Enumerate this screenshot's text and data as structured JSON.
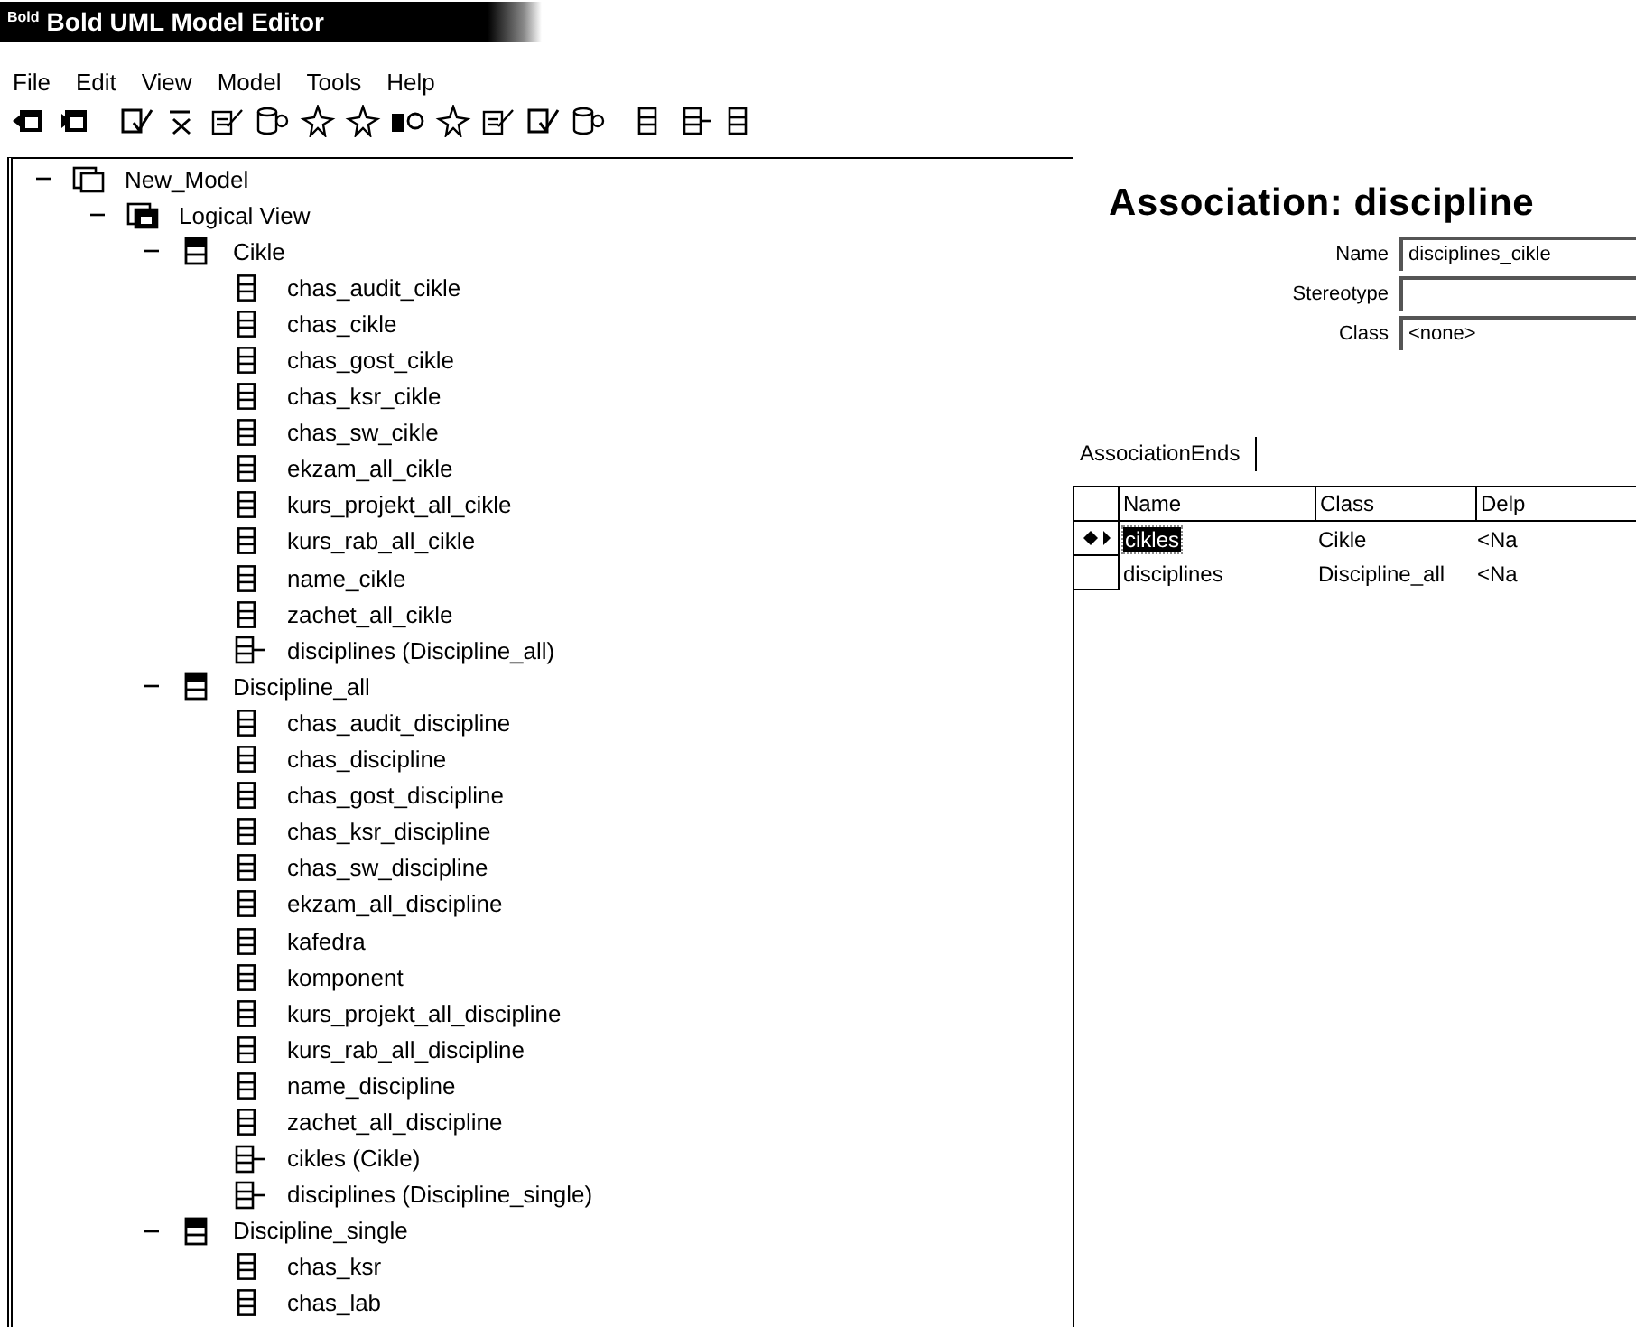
{
  "window": {
    "logo": "Bold",
    "title": "Bold UML Model Editor"
  },
  "menu": [
    "File",
    "Edit",
    "View",
    "Model",
    "Tools",
    "Help"
  ],
  "toolbar": [
    {
      "kind": "import"
    },
    {
      "kind": "export"
    },
    {
      "kind": "ocl"
    },
    {
      "kind": "name-check"
    },
    {
      "kind": "edit"
    },
    {
      "kind": "database"
    },
    {
      "kind": "link"
    },
    {
      "kind": "connect"
    },
    {
      "kind": "generate"
    },
    {
      "kind": "class-new"
    },
    {
      "kind": "doc"
    },
    {
      "kind": "doc-check"
    },
    {
      "kind": "stack"
    },
    {
      "kind": "attribute"
    },
    {
      "kind": "role"
    },
    {
      "kind": "attribute"
    }
  ],
  "tree": [
    {
      "label": "New_Model",
      "kind": "model",
      "expanded": true,
      "children": [
        {
          "label": "Logical View",
          "kind": "package",
          "expanded": true,
          "children": [
            {
              "label": "Cikle",
              "kind": "class",
              "expanded": true,
              "children": [
                {
                  "label": "chas_audit_cikle",
                  "kind": "attribute"
                },
                {
                  "label": "chas_cikle",
                  "kind": "attribute"
                },
                {
                  "label": "chas_gost_cikle",
                  "kind": "attribute"
                },
                {
                  "label": "chas_ksr_cikle",
                  "kind": "attribute"
                },
                {
                  "label": "chas_sw_cikle",
                  "kind": "attribute"
                },
                {
                  "label": "ekzam_all_cikle",
                  "kind": "attribute"
                },
                {
                  "label": "kurs_projekt_all_cikle",
                  "kind": "attribute"
                },
                {
                  "label": "kurs_rab_all_cikle",
                  "kind": "attribute"
                },
                {
                  "label": "name_cikle",
                  "kind": "attribute"
                },
                {
                  "label": "zachet_all_cikle",
                  "kind": "attribute"
                },
                {
                  "label": "disciplines (Discipline_all)",
                  "kind": "role"
                }
              ]
            },
            {
              "label": "Discipline_all",
              "kind": "class",
              "expanded": true,
              "children": [
                {
                  "label": "chas_audit_discipline",
                  "kind": "attribute"
                },
                {
                  "label": "chas_discipline",
                  "kind": "attribute"
                },
                {
                  "label": "chas_gost_discipline",
                  "kind": "attribute"
                },
                {
                  "label": "chas_ksr_discipline",
                  "kind": "attribute"
                },
                {
                  "label": "chas_sw_discipline",
                  "kind": "attribute"
                },
                {
                  "label": "ekzam_all_discipline",
                  "kind": "attribute"
                },
                {
                  "label": "kafedra",
                  "kind": "attribute"
                },
                {
                  "label": "komponent",
                  "kind": "attribute"
                },
                {
                  "label": "kurs_projekt_all_discipline",
                  "kind": "attribute"
                },
                {
                  "label": "kurs_rab_all_discipline",
                  "kind": "attribute"
                },
                {
                  "label": "name_discipline",
                  "kind": "attribute"
                },
                {
                  "label": "zachet_all_discipline",
                  "kind": "attribute"
                },
                {
                  "label": "cikles (Cikle)",
                  "kind": "role"
                },
                {
                  "label": "disciplines (Discipline_single)",
                  "kind": "role"
                }
              ]
            },
            {
              "label": "Discipline_single",
              "kind": "class",
              "expanded": true,
              "children": [
                {
                  "label": "chas_ksr",
                  "kind": "attribute"
                },
                {
                  "label": "chas_lab",
                  "kind": "attribute"
                }
              ]
            }
          ]
        }
      ]
    }
  ],
  "detail": {
    "heading": "Association: discipline",
    "fields": [
      {
        "label": "Name",
        "value": "disciplines_cikle"
      },
      {
        "label": "Stereotype"
      },
      {
        "label": "Class",
        "value": "<none>"
      }
    ],
    "tab": "AssociationEnds",
    "grid": {
      "columns": [
        "Name",
        "Class",
        "Delp"
      ],
      "rows": [
        {
          "selected": true,
          "cells": [
            "cikles",
            "Cikle",
            "<Na"
          ]
        },
        {
          "selected": false,
          "cells": [
            "disciplines",
            "Discipline_all",
            "<Na"
          ]
        }
      ]
    }
  }
}
